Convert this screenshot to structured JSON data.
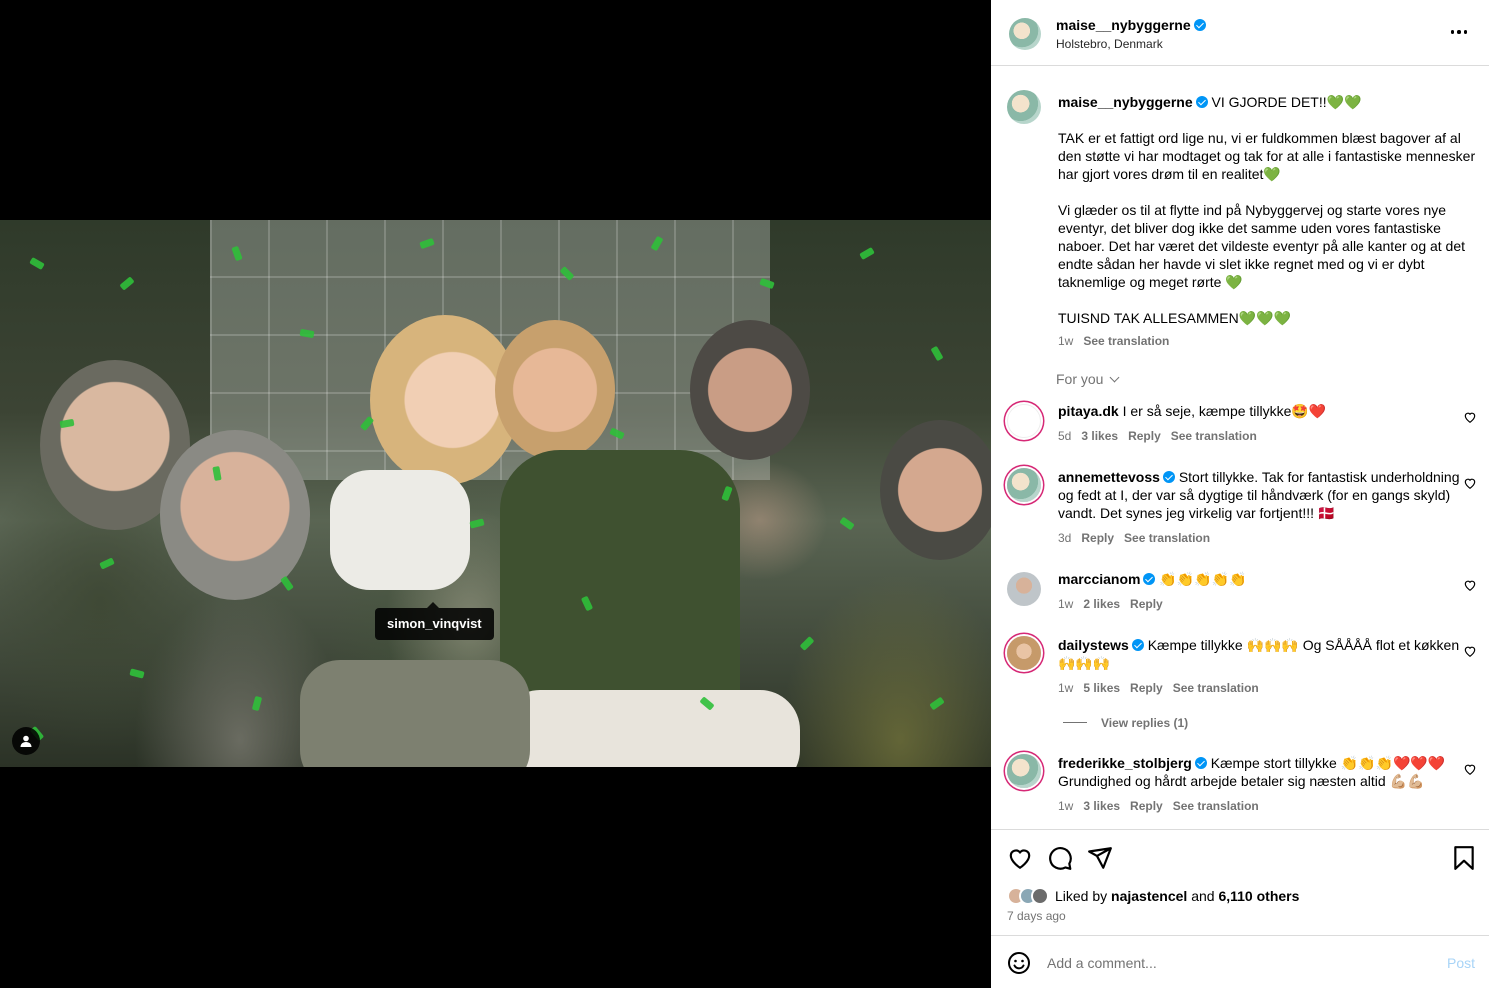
{
  "header": {
    "username": "maise__nybyggerne",
    "location": "Holstebro, Denmark"
  },
  "media": {
    "tagged_user": "simon_vinqvist"
  },
  "caption": {
    "username": "maise__nybyggerne",
    "paragraphs": [
      "VI GJORDE DET!!💚💚",
      "TAK er et fattigt ord lige nu, vi er fuldkommen blæst bagover af al den støtte vi har modtaget og tak for at alle i fantastiske mennesker har gjort vores drøm til en realitet💚",
      "Vi glæder os til at flytte ind på Nybyggervej og starte vores nye eventyr, det bliver dog ikke det samme uden vores fantastiske naboer. Det har været det vildeste eventyr på alle kanter og at det endte sådan her havde vi slet ikke regnet med og vi er dybt taknemlige og meget rørte 💚",
      "TUISND TAK ALLESAMMEN💚💚💚"
    ],
    "time": "1w",
    "see_translation": "See translation"
  },
  "for_you": "For you",
  "comments": [
    {
      "username": "pitaya.dk",
      "verified": false,
      "text": "I er så seje, kæmpe tillykke🤩❤️",
      "time": "5d",
      "likes": "3 likes",
      "reply": "Reply",
      "translation": "See translation"
    },
    {
      "username": "annemettevoss",
      "verified": true,
      "text": "Stort tillykke. Tak for fantastisk underholdning og fedt at I, der var så dygtige til håndværk (for en gangs skyld) vandt. Det synes jeg virkelig var fortjent!!! 🇩🇰",
      "time": "3d",
      "likes": "",
      "reply": "Reply",
      "translation": "See translation"
    },
    {
      "username": "marccianom",
      "verified": true,
      "text": "👏👏👏👏👏",
      "time": "1w",
      "likes": "2 likes",
      "reply": "Reply",
      "translation": ""
    },
    {
      "username": "dailystews",
      "verified": true,
      "text": "Kæmpe tillykke 🙌🙌🙌 Og SÅÅÅÅ flot et køkken 🙌🙌🙌",
      "time": "1w",
      "likes": "5 likes",
      "reply": "Reply",
      "translation": "See translation"
    },
    {
      "username": "frederikke_stolbjerg",
      "verified": true,
      "text": "Kæmpe stort tillykke 👏👏👏❤️❤️❤️ Grundighed og hårdt arbejde betaler sig næsten altid 💪🏼💪🏼",
      "time": "1w",
      "likes": "3 likes",
      "reply": "Reply",
      "translation": "See translation"
    }
  ],
  "view_replies": "View replies (1)",
  "likes": {
    "prefix": "Liked by ",
    "user": "najastencel",
    "middle": " and ",
    "others": "6,110 others"
  },
  "time_ago": "7 days ago",
  "comment_box": {
    "placeholder": "Add a comment...",
    "post_label": "Post"
  },
  "colors": {
    "accent": "#0095f6",
    "confetti": "#2fbf3a",
    "like_red": "#ed4956"
  },
  "icons": [
    "heart-icon",
    "comment-icon",
    "share-icon",
    "bookmark-icon",
    "emoji-icon",
    "more-icon",
    "user-tag-icon",
    "verified-icon",
    "chevron-down-icon"
  ]
}
